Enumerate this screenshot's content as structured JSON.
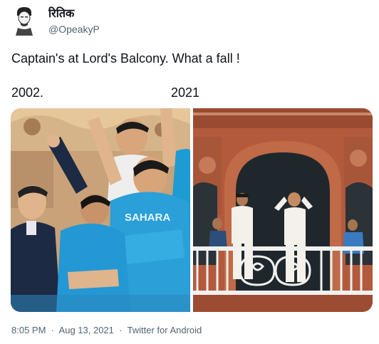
{
  "user": {
    "display_name": "रितिक",
    "handle": "@OpeakyP"
  },
  "tweet": {
    "text": "Captain's at Lord's Balcony. What a fall !",
    "label_left": "2002.",
    "label_right": "2021"
  },
  "photo_left": {
    "shirt_text": "SAHARA"
  },
  "footer": {
    "time": "8:05 PM",
    "date": "Aug 13, 2021",
    "source": "Twitter for Android",
    "separator": "·"
  },
  "colors": {
    "primary_text": "#0f1419",
    "secondary_text": "#536471",
    "jersey_blue": "#2a9fd8",
    "brick": "#b45a3c",
    "cream_whites": "#f3f1ea"
  }
}
